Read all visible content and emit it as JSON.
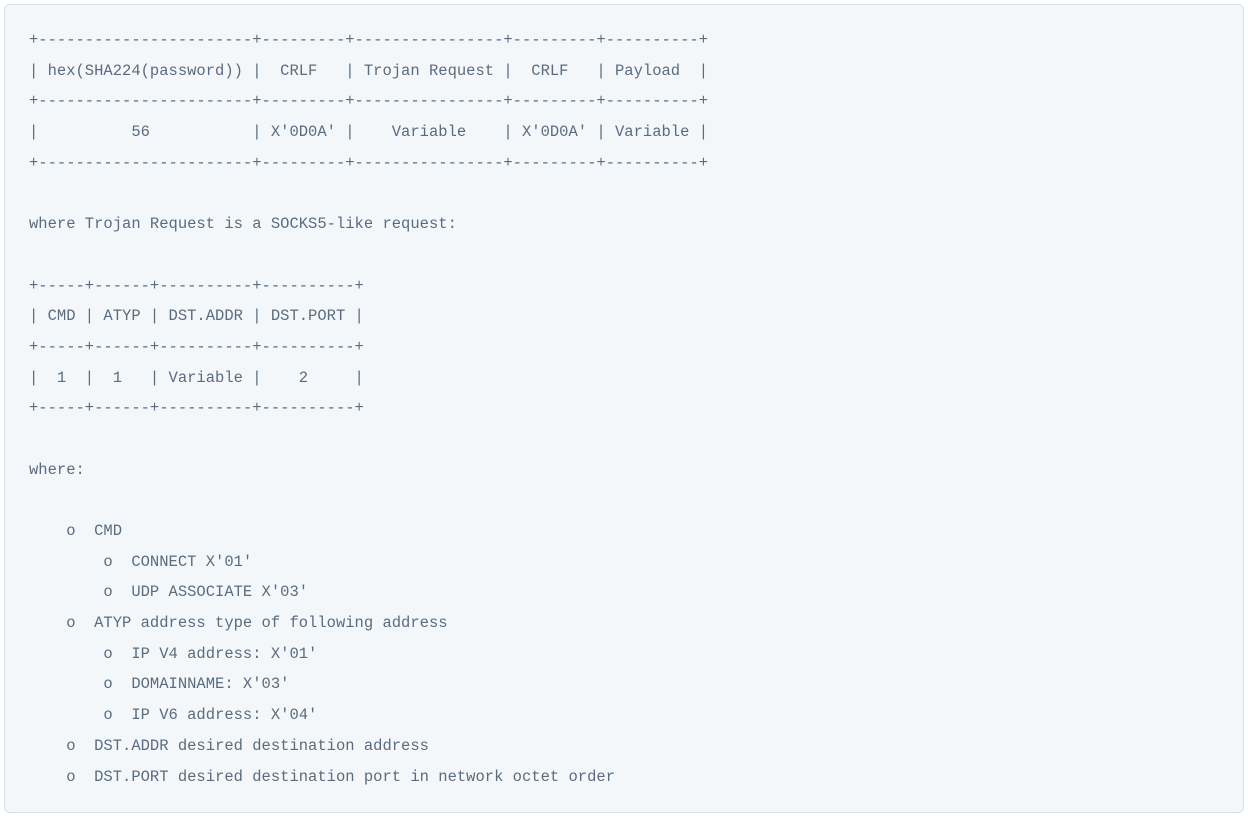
{
  "content": "+-----------------------+---------+----------------+---------+----------+\n| hex(SHA224(password)) |  CRLF   | Trojan Request |  CRLF   | Payload  |\n+-----------------------+---------+----------------+---------+----------+\n|          56           | X'0D0A' |    Variable    | X'0D0A' | Variable |\n+-----------------------+---------+----------------+---------+----------+\n\nwhere Trojan Request is a SOCKS5-like request:\n\n+-----+------+----------+----------+\n| CMD | ATYP | DST.ADDR | DST.PORT |\n+-----+------+----------+----------+\n|  1  |  1   | Variable |    2     |\n+-----+------+----------+----------+\n\nwhere:\n\n    o  CMD\n        o  CONNECT X'01'\n        o  UDP ASSOCIATE X'03'\n    o  ATYP address type of following address\n        o  IP V4 address: X'01'\n        o  DOMAINNAME: X'03'\n        o  IP V6 address: X'04'\n    o  DST.ADDR desired destination address\n    o  DST.PORT desired destination port in network octet order"
}
